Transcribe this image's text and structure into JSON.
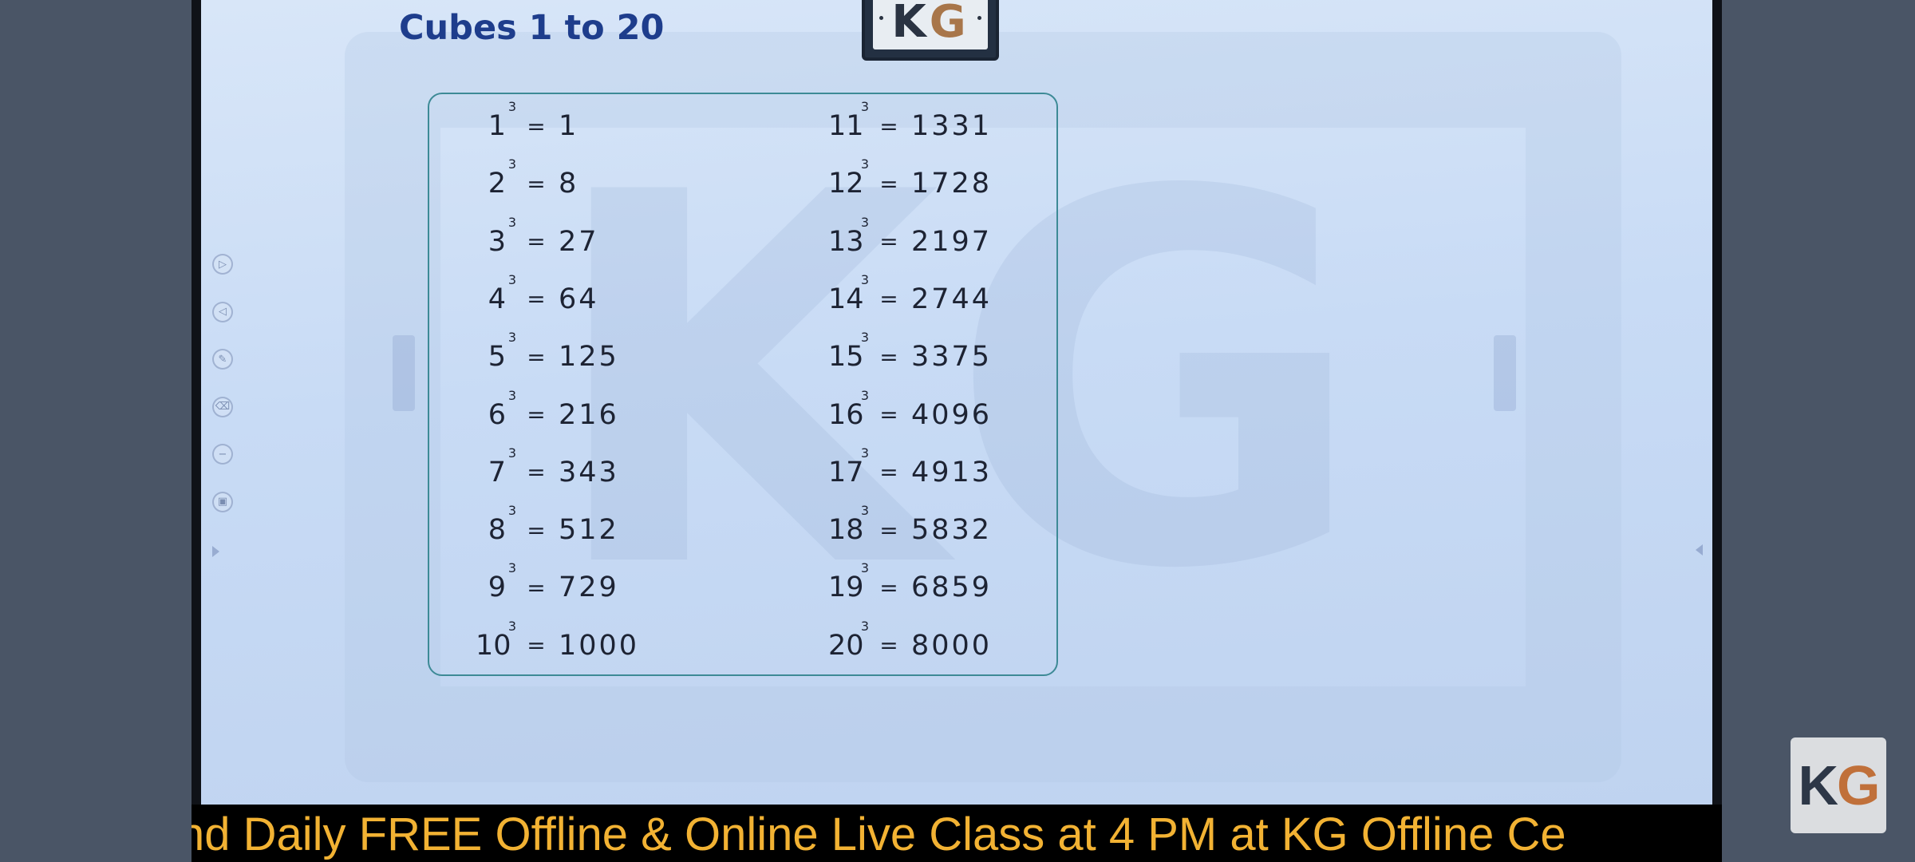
{
  "slide": {
    "title": "Cubes 1 to 20",
    "logo": {
      "k": "K",
      "g": "G"
    },
    "watermark": "KG"
  },
  "cubes": {
    "exponent": "3",
    "equals": "=",
    "left": [
      {
        "base": "1",
        "value": "1"
      },
      {
        "base": "2",
        "value": "8"
      },
      {
        "base": "3",
        "value": "27"
      },
      {
        "base": "4",
        "value": "64"
      },
      {
        "base": "5",
        "value": "125"
      },
      {
        "base": "6",
        "value": "216"
      },
      {
        "base": "7",
        "value": "343"
      },
      {
        "base": "8",
        "value": "512"
      },
      {
        "base": "9",
        "value": "729"
      },
      {
        "base": "10",
        "value": "1000"
      }
    ],
    "right": [
      {
        "base": "11",
        "value": "1331"
      },
      {
        "base": "12",
        "value": "1728"
      },
      {
        "base": "13",
        "value": "2197"
      },
      {
        "base": "14",
        "value": "2744"
      },
      {
        "base": "15",
        "value": "3375"
      },
      {
        "base": "16",
        "value": "4096"
      },
      {
        "base": "17",
        "value": "4913"
      },
      {
        "base": "18",
        "value": "5832"
      },
      {
        "base": "19",
        "value": "6859"
      },
      {
        "base": "20",
        "value": "8000"
      }
    ]
  },
  "toolbar": {
    "tools": [
      {
        "name": "play-icon",
        "glyph": "▷"
      },
      {
        "name": "back-icon",
        "glyph": "◁"
      },
      {
        "name": "pen-icon",
        "glyph": "✎"
      },
      {
        "name": "eraser-icon",
        "glyph": "⌫"
      },
      {
        "name": "minus-icon",
        "glyph": "−"
      },
      {
        "name": "screen-icon",
        "glyph": "▣"
      }
    ]
  },
  "ticker": {
    "text": "nd Daily FREE Offline & Online Live Class at 4 PM at KG Offline Ce"
  },
  "corner_logo": {
    "k": "K",
    "g": "G"
  },
  "colors": {
    "title": "#1e3d8c",
    "ticker_text": "#f2b233",
    "table_border": "#3d8a96"
  }
}
